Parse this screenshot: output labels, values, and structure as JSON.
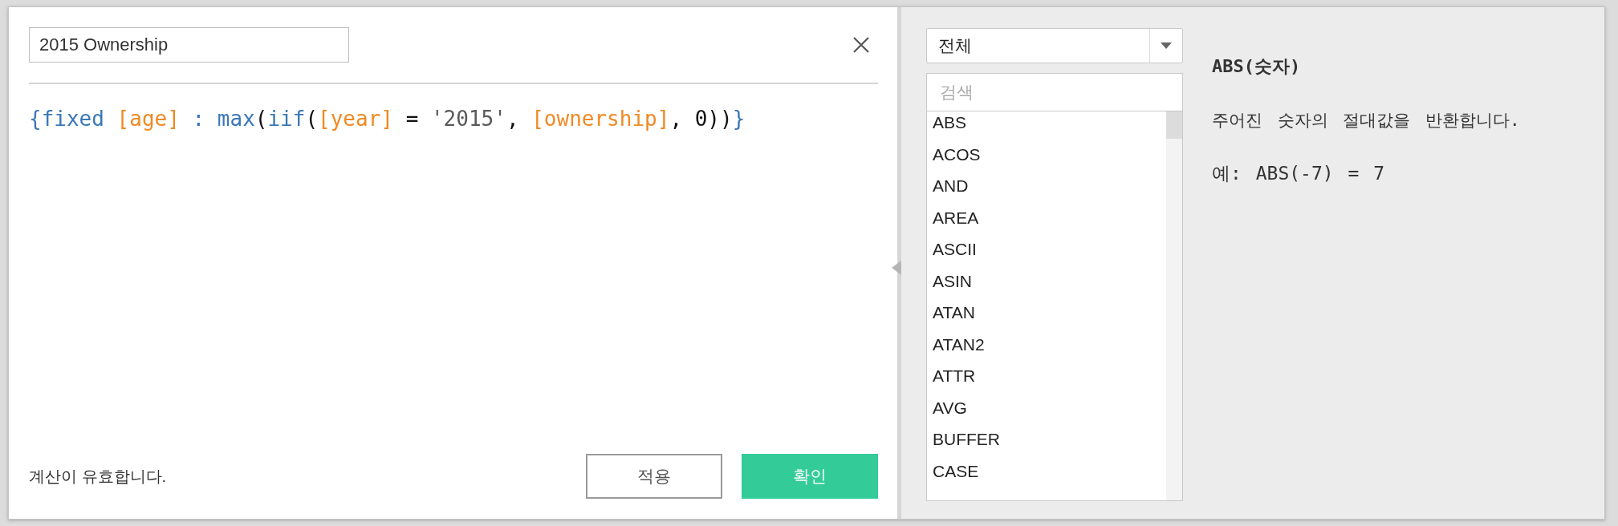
{
  "name_field": {
    "value": "2015 Ownership"
  },
  "formula": [
    {
      "kind": "keyword",
      "text": "{fixed "
    },
    {
      "kind": "field",
      "text": "[age]"
    },
    {
      "kind": "keyword",
      "text": " : max"
    },
    {
      "kind": "plain",
      "text": "("
    },
    {
      "kind": "keyword",
      "text": "iif"
    },
    {
      "kind": "plain",
      "text": "("
    },
    {
      "kind": "field",
      "text": "[year]"
    },
    {
      "kind": "plain",
      "text": " = "
    },
    {
      "kind": "string",
      "text": "'2015'"
    },
    {
      "kind": "plain",
      "text": ", "
    },
    {
      "kind": "field",
      "text": "[ownership]"
    },
    {
      "kind": "plain",
      "text": ", 0))"
    },
    {
      "kind": "keyword",
      "text": "}"
    }
  ],
  "status": "계산이 유효합니다.",
  "buttons": [
    {
      "kind": "secondary",
      "label": "적용"
    },
    {
      "kind": "primary",
      "label": "확인"
    }
  ],
  "category_dropdown": {
    "value": "전체"
  },
  "search": {
    "placeholder": "검색"
  },
  "functions": [
    "ABS",
    "ACOS",
    "AND",
    "AREA",
    "ASCII",
    "ASIN",
    "ATAN",
    "ATAN2",
    "ATTR",
    "AVG",
    "BUFFER",
    "CASE"
  ],
  "help": {
    "signature": "ABS(숫자)",
    "description": "주어진 숫자의 절대값을 반환합니다.",
    "example": "예: ABS(-7) = 7"
  }
}
